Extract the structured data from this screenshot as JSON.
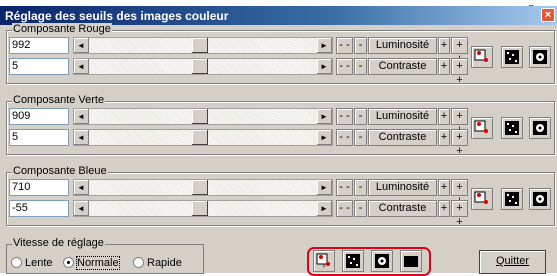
{
  "page": {
    "partial_text": "g"
  },
  "window": {
    "title": "Réglage des seuils des images couleur",
    "close": "×"
  },
  "groups": [
    {
      "label": "Composante Rouge",
      "value1": "992",
      "value2": "5",
      "thumb1_percent": 48,
      "thumb2_percent": 48
    },
    {
      "label": "Composante Verte",
      "value1": "909",
      "value2": "5",
      "thumb1_percent": 48,
      "thumb2_percent": 48
    },
    {
      "label": "Composante Bleue",
      "value1": "710",
      "value2": "-55",
      "thumb1_percent": 48,
      "thumb2_percent": 48
    }
  ],
  "controls": {
    "minus_minus": "- -",
    "minus": "-",
    "plus": "+",
    "plus_plus": "+ +",
    "luminosite": "Luminosité",
    "contraste": "Contraste",
    "arrow_left": "◄",
    "arrow_right": "►"
  },
  "speed": {
    "label": "Vitesse de réglage",
    "options": [
      "Lente",
      "Normale",
      "Rapide"
    ],
    "selected": "Normale"
  },
  "quit_label": "Quitter",
  "icons": [
    "red-dots-icon",
    "noise-pattern-icon",
    "gear-dot-icon",
    "black-square-icon"
  ],
  "colors": {
    "title_start": "#0a246a",
    "title_end": "#a6caf0",
    "highlight": "#e0001b",
    "face": "#d4d0c8"
  }
}
